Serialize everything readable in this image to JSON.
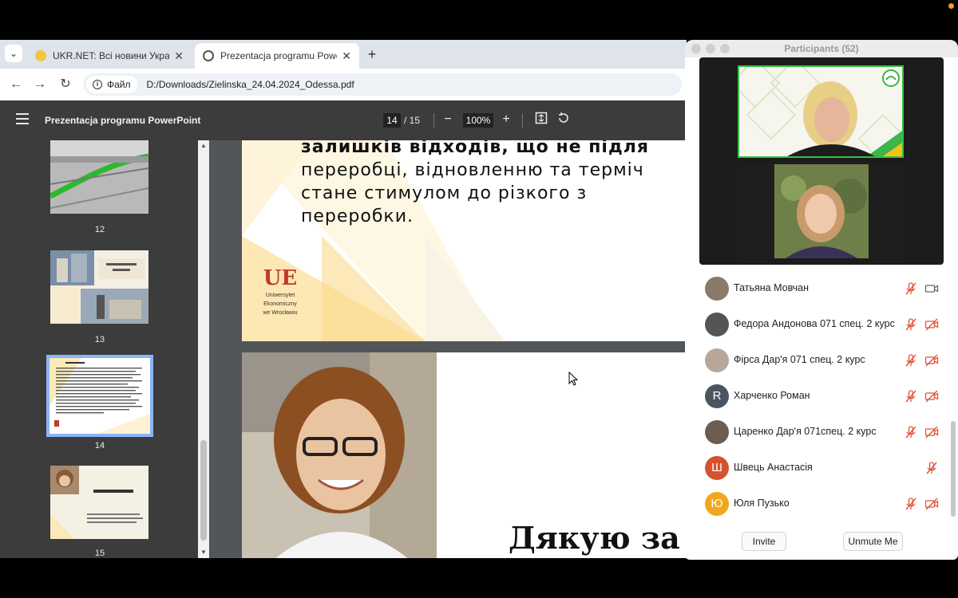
{
  "browser": {
    "tabs": [
      {
        "title": "UKR.NET: Всі новини України",
        "favicon_color": "#f4c542"
      },
      {
        "title": "Prezentacja programu PowerPoint",
        "favicon_color": "#555555"
      }
    ],
    "active_tab_index": 1,
    "site_chip": "Файл",
    "url": "D:/Downloads/Zielinska_24.04.2024_Odessa.pdf"
  },
  "pdf": {
    "title": "Prezentacja programu PowerPoint",
    "current_page": "14",
    "total_pages": "/ 15",
    "zoom": "100%",
    "thumbnails": [
      "12",
      "13",
      "14",
      "15"
    ],
    "selected_thumbnail": "14",
    "page14_lines": [
      "залишків відходів, що не підля",
      "переробці, відновленню та терміч",
      "стане стимулом до різкого з",
      "переробки."
    ],
    "logo": {
      "mark": "UE",
      "name_lines": [
        "Uniwersytet",
        "Ekonomiczny",
        "we Wrocławiu"
      ]
    },
    "page15_title": "Дякую за у"
  },
  "zoom_panel": {
    "title": "Participants (52)",
    "participants": [
      {
        "name": "Татьяна Мовчан",
        "avatar_letter": "",
        "avatar_color": "#8a7a6a",
        "mic_muted": true,
        "video": "on"
      },
      {
        "name": "Федора Андонова 071 спец. 2 курс",
        "avatar_letter": "",
        "avatar_color": "#555555",
        "mic_muted": true,
        "video": "off"
      },
      {
        "name": "Фірса Дар'я  071 спец. 2 курс",
        "avatar_letter": "",
        "avatar_color": "#b7a79a",
        "mic_muted": true,
        "video": "off"
      },
      {
        "name": "Харченко Роман",
        "avatar_letter": "R",
        "avatar_color": "#4a5561",
        "mic_muted": true,
        "video": "off"
      },
      {
        "name": "Царенко Дар'я  071спец. 2 курс",
        "avatar_letter": "",
        "avatar_color": "#6d5d50",
        "mic_muted": true,
        "video": "off"
      },
      {
        "name": "Швець Анастасія",
        "avatar_letter": "Ш",
        "avatar_color": "#d4532f",
        "mic_muted": true,
        "video": "none"
      },
      {
        "name": "Юля Пузько",
        "avatar_letter": "Ю",
        "avatar_color": "#f2a721",
        "mic_muted": true,
        "video": "off"
      }
    ],
    "invite_label": "Invite",
    "unmute_label": "Unmute Me"
  }
}
